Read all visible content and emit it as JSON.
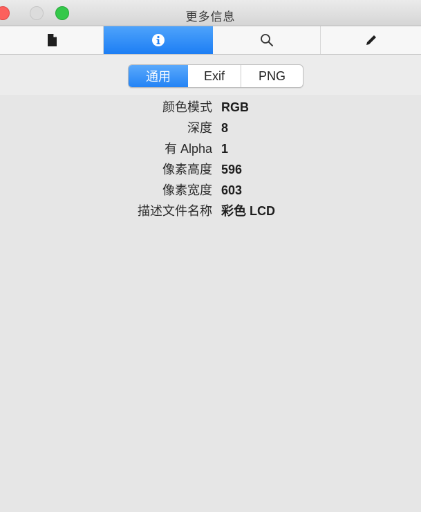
{
  "window": {
    "title": "更多信息"
  },
  "toolbar": {
    "tabs": [
      {
        "icon": "document-icon"
      },
      {
        "icon": "info-icon",
        "active": true
      },
      {
        "icon": "search-icon"
      },
      {
        "icon": "pencil-icon"
      }
    ]
  },
  "segments": {
    "items": [
      "通用",
      "Exif",
      "PNG"
    ],
    "selected": "通用"
  },
  "info": {
    "rows": [
      {
        "label": "颜色模式",
        "value": "RGB"
      },
      {
        "label": "深度",
        "value": "8"
      },
      {
        "label": "有 Alpha",
        "value": "1"
      },
      {
        "label": "像素高度",
        "value": "596"
      },
      {
        "label": "像素宽度",
        "value": "603"
      },
      {
        "label": "描述文件名称",
        "value": "彩色 LCD"
      }
    ]
  },
  "colors": {
    "accent": "#1d7ef4",
    "close": "#fc605c",
    "zoom": "#34c84a",
    "background": "#c99a1e"
  }
}
